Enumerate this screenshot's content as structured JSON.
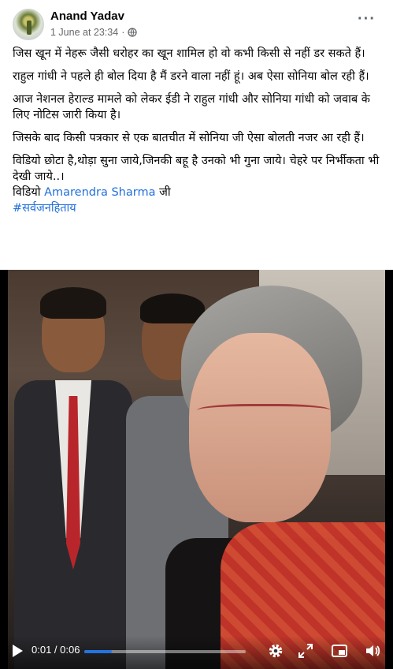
{
  "post": {
    "author": "Anand Yadav",
    "timestamp": "1 June at 23:34",
    "separator": "·",
    "more_label": "···",
    "paragraphs": [
      "जिस खून में नेहरू जैसी धरोहर का खून शामिल हो वो कभी किसी से नहीं डर सकते हैं।",
      "राहुल गांधी ने पहले ही बोल दिया है मैं डरने वाला नहीं हूं। अब ऐसा सोनिया बोल रही हैं।",
      "आज नेशनल हेराल्ड मामले को लेकर ईडी ने राहुल गांधी और सोनिया गांधी को जवाब के लिए नोटिस जारी किया है।",
      "जिसके बाद किसी पत्रकार से एक बातचीत में सोनिया जी ऐसा बोलती नजर आ रही हैं।",
      "विडियो छोटा है,थोड़ा सुना जाये,जिनकी बहू है उनको भी गुना जाये। चेहरे पर निर्भीकता भी देखी जाये..।"
    ],
    "credit_prefix": "विडियो",
    "credit_link": "Amarendra Sharma",
    "credit_suffix": "जी",
    "hashtag": "#सर्वजनहिताय"
  },
  "video": {
    "current_time": "0:01",
    "duration": "0:06",
    "time_display": "0:01 / 0:06",
    "progress": 0.17
  },
  "icons": {
    "avatar": "profile-avatar",
    "privacy": "globe-icon",
    "play": "play-icon",
    "settings": "gear-icon",
    "fullscreen": "expand-icon",
    "pip": "picture-in-picture-icon",
    "volume": "volume-icon"
  },
  "colors": {
    "link": "#216fdb",
    "progress": "#2374e1",
    "meta": "#65676b"
  }
}
